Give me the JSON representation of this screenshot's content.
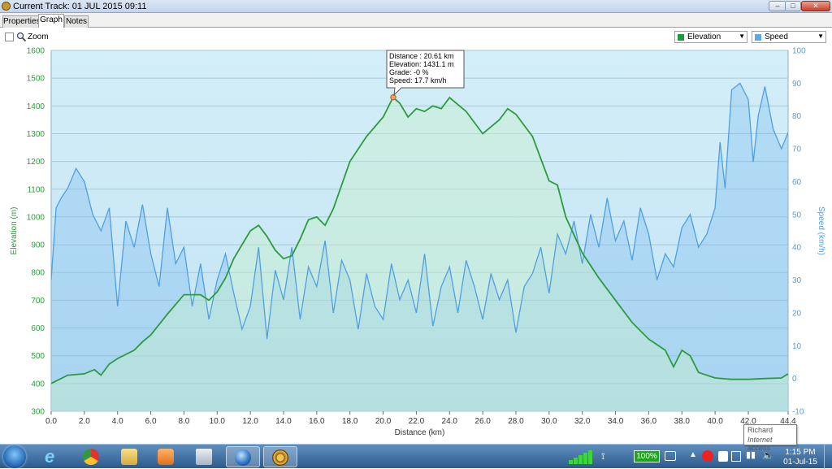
{
  "window": {
    "title": "Current Track: 01 JUL 2015 09:11",
    "controls": {
      "minimize": "–",
      "maximize": "□",
      "close": "✕"
    }
  },
  "tabs": [
    {
      "label": "Properties",
      "active": false
    },
    {
      "label": "Graph",
      "active": true
    },
    {
      "label": "Notes",
      "active": false
    }
  ],
  "toolbar": {
    "zoom_label": "Zoom",
    "zoom_checked": false,
    "left_axis_select": {
      "value": "Elevation",
      "color": "#1e9b3a"
    },
    "right_axis_select": {
      "value": "Speed",
      "color": "#5aaae8"
    }
  },
  "chart_data": {
    "type": "line",
    "xlabel": "Distance  (km)",
    "ylabel_left": "Elevation (m)",
    "ylabel_right": "Speed (km/h)",
    "xlim": [
      0,
      44.4
    ],
    "ylim_left": [
      300,
      1600
    ],
    "ylim_right": [
      -10,
      100
    ],
    "x_ticks": [
      "0.0",
      "2.0",
      "4.0",
      "6.0",
      "8.0",
      "10.0",
      "12.0",
      "14.0",
      "16.0",
      "18.0",
      "20.0",
      "22.0",
      "24.0",
      "26.0",
      "28.0",
      "30.0",
      "32.0",
      "34.0",
      "36.0",
      "38.0",
      "40.0",
      "42.0",
      "44.4"
    ],
    "y_ticks_left": [
      "1600",
      "1500",
      "1400",
      "1300",
      "1200",
      "1100",
      "1000",
      "900",
      "800",
      "700",
      "600",
      "500",
      "400",
      "300"
    ],
    "y_ticks_right": [
      "100",
      "90",
      "80",
      "70",
      "60",
      "50",
      "40",
      "30",
      "20",
      "10",
      "0",
      "-10"
    ],
    "grid": true,
    "series": [
      {
        "name": "Elevation",
        "axis": "left",
        "color": "#2e9a3e",
        "x": [
          0,
          1,
          2,
          2.6,
          3,
          3.5,
          4,
          5,
          5.5,
          6,
          7,
          8,
          9,
          9.5,
          10,
          10.5,
          11,
          12,
          12.5,
          13,
          13.5,
          14,
          14.5,
          15,
          15.5,
          16,
          16.5,
          17,
          18,
          19,
          20,
          20.6,
          21,
          21.5,
          22,
          22.5,
          23,
          23.5,
          24,
          25,
          26,
          27,
          27.5,
          28,
          29,
          30,
          30.5,
          31,
          32,
          33,
          34,
          35,
          36,
          37,
          37.5,
          38,
          38.5,
          39,
          40,
          41,
          42,
          43,
          44,
          44.4
        ],
        "y": [
          400,
          430,
          435,
          450,
          430,
          470,
          490,
          520,
          550,
          575,
          650,
          720,
          720,
          700,
          730,
          780,
          850,
          950,
          970,
          930,
          880,
          850,
          860,
          920,
          990,
          1000,
          970,
          1030,
          1200,
          1290,
          1360,
          1431,
          1410,
          1360,
          1390,
          1380,
          1400,
          1390,
          1430,
          1380,
          1300,
          1350,
          1390,
          1370,
          1290,
          1130,
          1115,
          1000,
          870,
          780,
          700,
          620,
          560,
          520,
          460,
          520,
          500,
          440,
          420,
          415,
          415,
          418,
          420,
          435
        ]
      },
      {
        "name": "Speed",
        "axis": "right",
        "color": "#4f9fe3",
        "x": [
          0,
          0.3,
          0.6,
          1,
          1.5,
          2,
          2.5,
          3,
          3.5,
          4,
          4.5,
          5,
          5.5,
          6,
          6.5,
          7,
          7.5,
          8,
          8.5,
          9,
          9.5,
          10,
          10.5,
          11,
          11.5,
          12,
          12.5,
          13,
          13.5,
          14,
          14.5,
          15,
          15.5,
          16,
          16.5,
          17,
          17.5,
          18,
          18.5,
          19,
          19.5,
          20,
          20.5,
          21,
          21.5,
          22,
          22.5,
          23,
          23.5,
          24,
          24.5,
          25,
          25.5,
          26,
          26.5,
          27,
          27.5,
          28,
          28.5,
          29,
          29.5,
          30,
          30.5,
          31,
          31.5,
          32,
          32.5,
          33,
          33.5,
          34,
          34.5,
          35,
          35.5,
          36,
          36.5,
          37,
          37.5,
          38,
          38.5,
          39,
          39.5,
          40,
          40.3,
          40.6,
          41,
          41.5,
          42,
          42.3,
          42.6,
          43,
          43.5,
          44,
          44.4
        ],
        "y": [
          30,
          52,
          55,
          58,
          64,
          60,
          50,
          45,
          52,
          22,
          48,
          40,
          53,
          38,
          28,
          52,
          35,
          40,
          22,
          35,
          18,
          30,
          38,
          26,
          15,
          22,
          40,
          12,
          33,
          24,
          40,
          18,
          34,
          28,
          42,
          20,
          36,
          30,
          15,
          32,
          22,
          18,
          35,
          24,
          30,
          20,
          38,
          16,
          28,
          34,
          20,
          36,
          28,
          18,
          32,
          24,
          30,
          14,
          28,
          32,
          40,
          26,
          44,
          38,
          48,
          35,
          50,
          40,
          55,
          42,
          48,
          36,
          52,
          44,
          30,
          38,
          34,
          46,
          50,
          40,
          44,
          52,
          72,
          58,
          88,
          90,
          85,
          66,
          80,
          89,
          76,
          70,
          75
        ]
      }
    ],
    "annotation": {
      "distance": "Distance : 20.61 km",
      "elevation": "Elevation: 1431.1 m",
      "grade": "Grade: -0 %",
      "speed": "Speed: 17.7 km/h",
      "x": 20.61,
      "y": 1431.1
    }
  },
  "taskbar": {
    "battery": "100%",
    "time": "1:15 PM",
    "date": "01-Jul-15",
    "apps": [
      "windows-explorer",
      "internet-explorer",
      "chrome",
      "file-explorer",
      "media-player",
      "calculator",
      "google-earth",
      "basecamp"
    ]
  },
  "network_tooltip": {
    "name": "Richard",
    "status": "Internet access"
  }
}
